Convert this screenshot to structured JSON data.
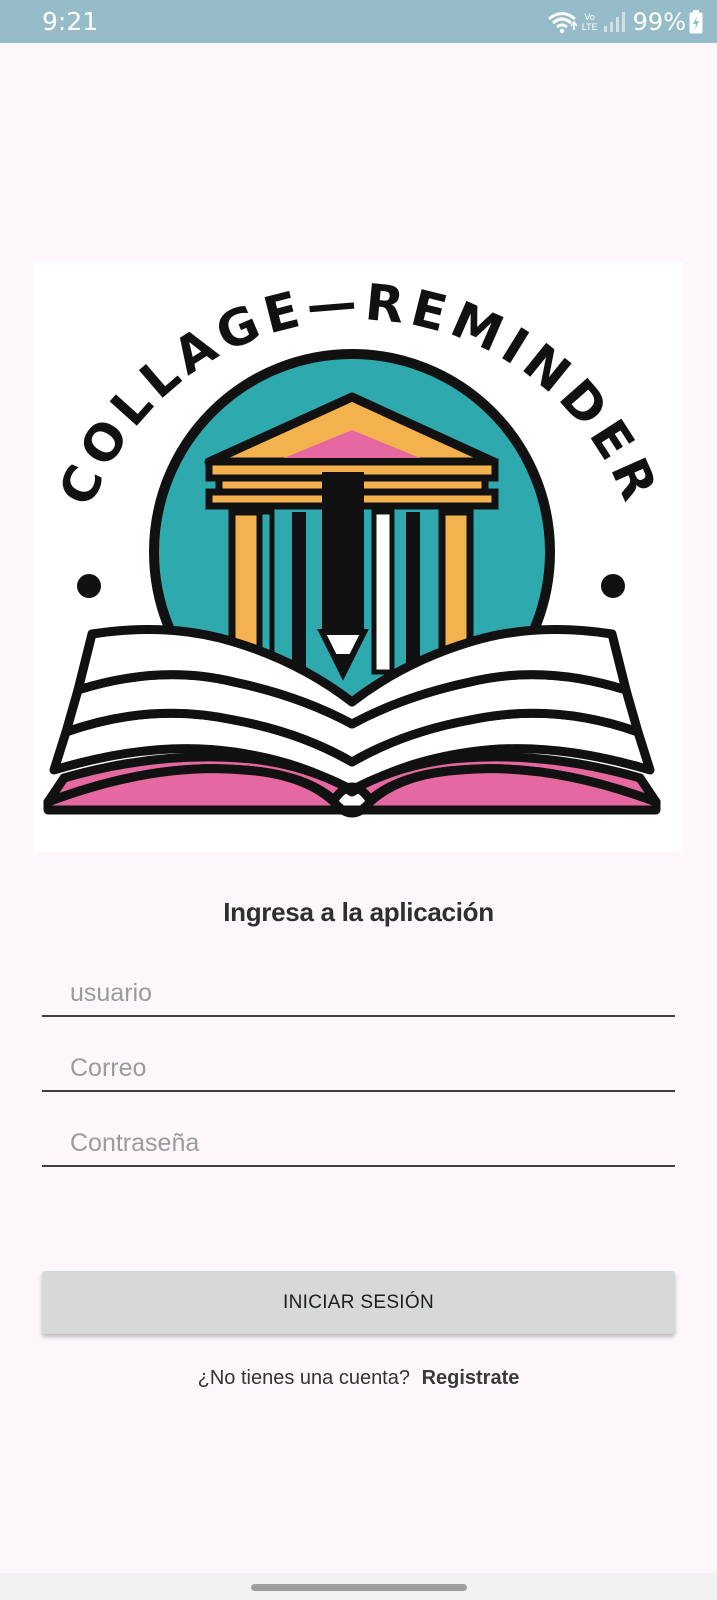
{
  "status_bar": {
    "time": "9:21",
    "battery": "99%",
    "network_label": "Vo LTE"
  },
  "logo": {
    "left_word": "COLLAGE",
    "right_word": "REMINDER",
    "colors": {
      "teal": "#2ea9ae",
      "orange": "#f3b24d",
      "pink": "#e569a0",
      "outline": "#111111"
    }
  },
  "form": {
    "title": "Ingresa a la aplicación",
    "username_placeholder": "usuario",
    "email_placeholder": "Correo",
    "password_placeholder": "Contraseña",
    "submit_label": "INICIAR SESIÓN"
  },
  "register": {
    "prompt": "¿No tienes una cuenta?",
    "link_label": "Registrate"
  },
  "accent_colors": {
    "status_bar": "#95bcc8",
    "background": "#fdf7fb",
    "button": "#d7d8d8"
  }
}
